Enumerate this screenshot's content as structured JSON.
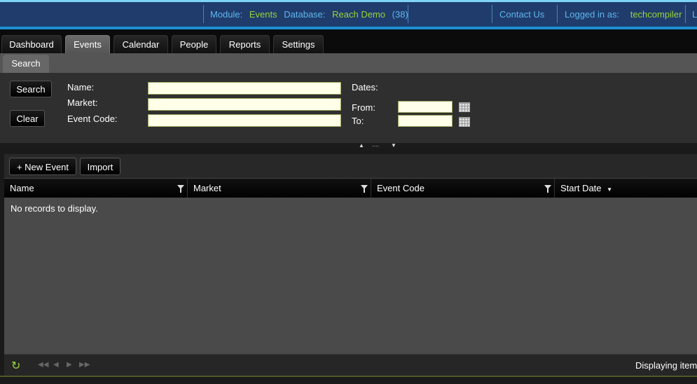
{
  "header": {
    "module_label": "Module:",
    "module_value": "Events",
    "database_label": "Database:",
    "database_value": "Reach Demo",
    "database_count": "(38)",
    "contact_link": "Contact Us",
    "logged_in_label": "Logged in as:",
    "user": "techcompiler",
    "cut_link": "L"
  },
  "tabs": [
    {
      "label": "Dashboard"
    },
    {
      "label": "Events"
    },
    {
      "label": "Calendar"
    },
    {
      "label": "People"
    },
    {
      "label": "Reports"
    },
    {
      "label": "Settings"
    }
  ],
  "active_tab": "Events",
  "search": {
    "tab_label": "Search",
    "search_button": "Search",
    "clear_button": "Clear",
    "name_label": "Name:",
    "market_label": "Market:",
    "event_code_label": "Event Code:",
    "dates_label": "Dates:",
    "from_label": "From:",
    "to_label": "To:",
    "name_value": "",
    "market_value": "",
    "event_code_value": "",
    "from_value": "",
    "to_value": ""
  },
  "splitter": {
    "dots": "...."
  },
  "grid": {
    "new_event_button": "+ New Event",
    "import_button": "Import",
    "columns": [
      "Name",
      "Market",
      "Event Code",
      "Start Date"
    ],
    "empty_message": "No records to display.",
    "status_text": "Displaying item"
  },
  "colors": {
    "header_bg": "#1f3c6c",
    "header_label": "#5fb6ee",
    "header_value": "#9ad43a",
    "input_bg": "#ffffea"
  }
}
